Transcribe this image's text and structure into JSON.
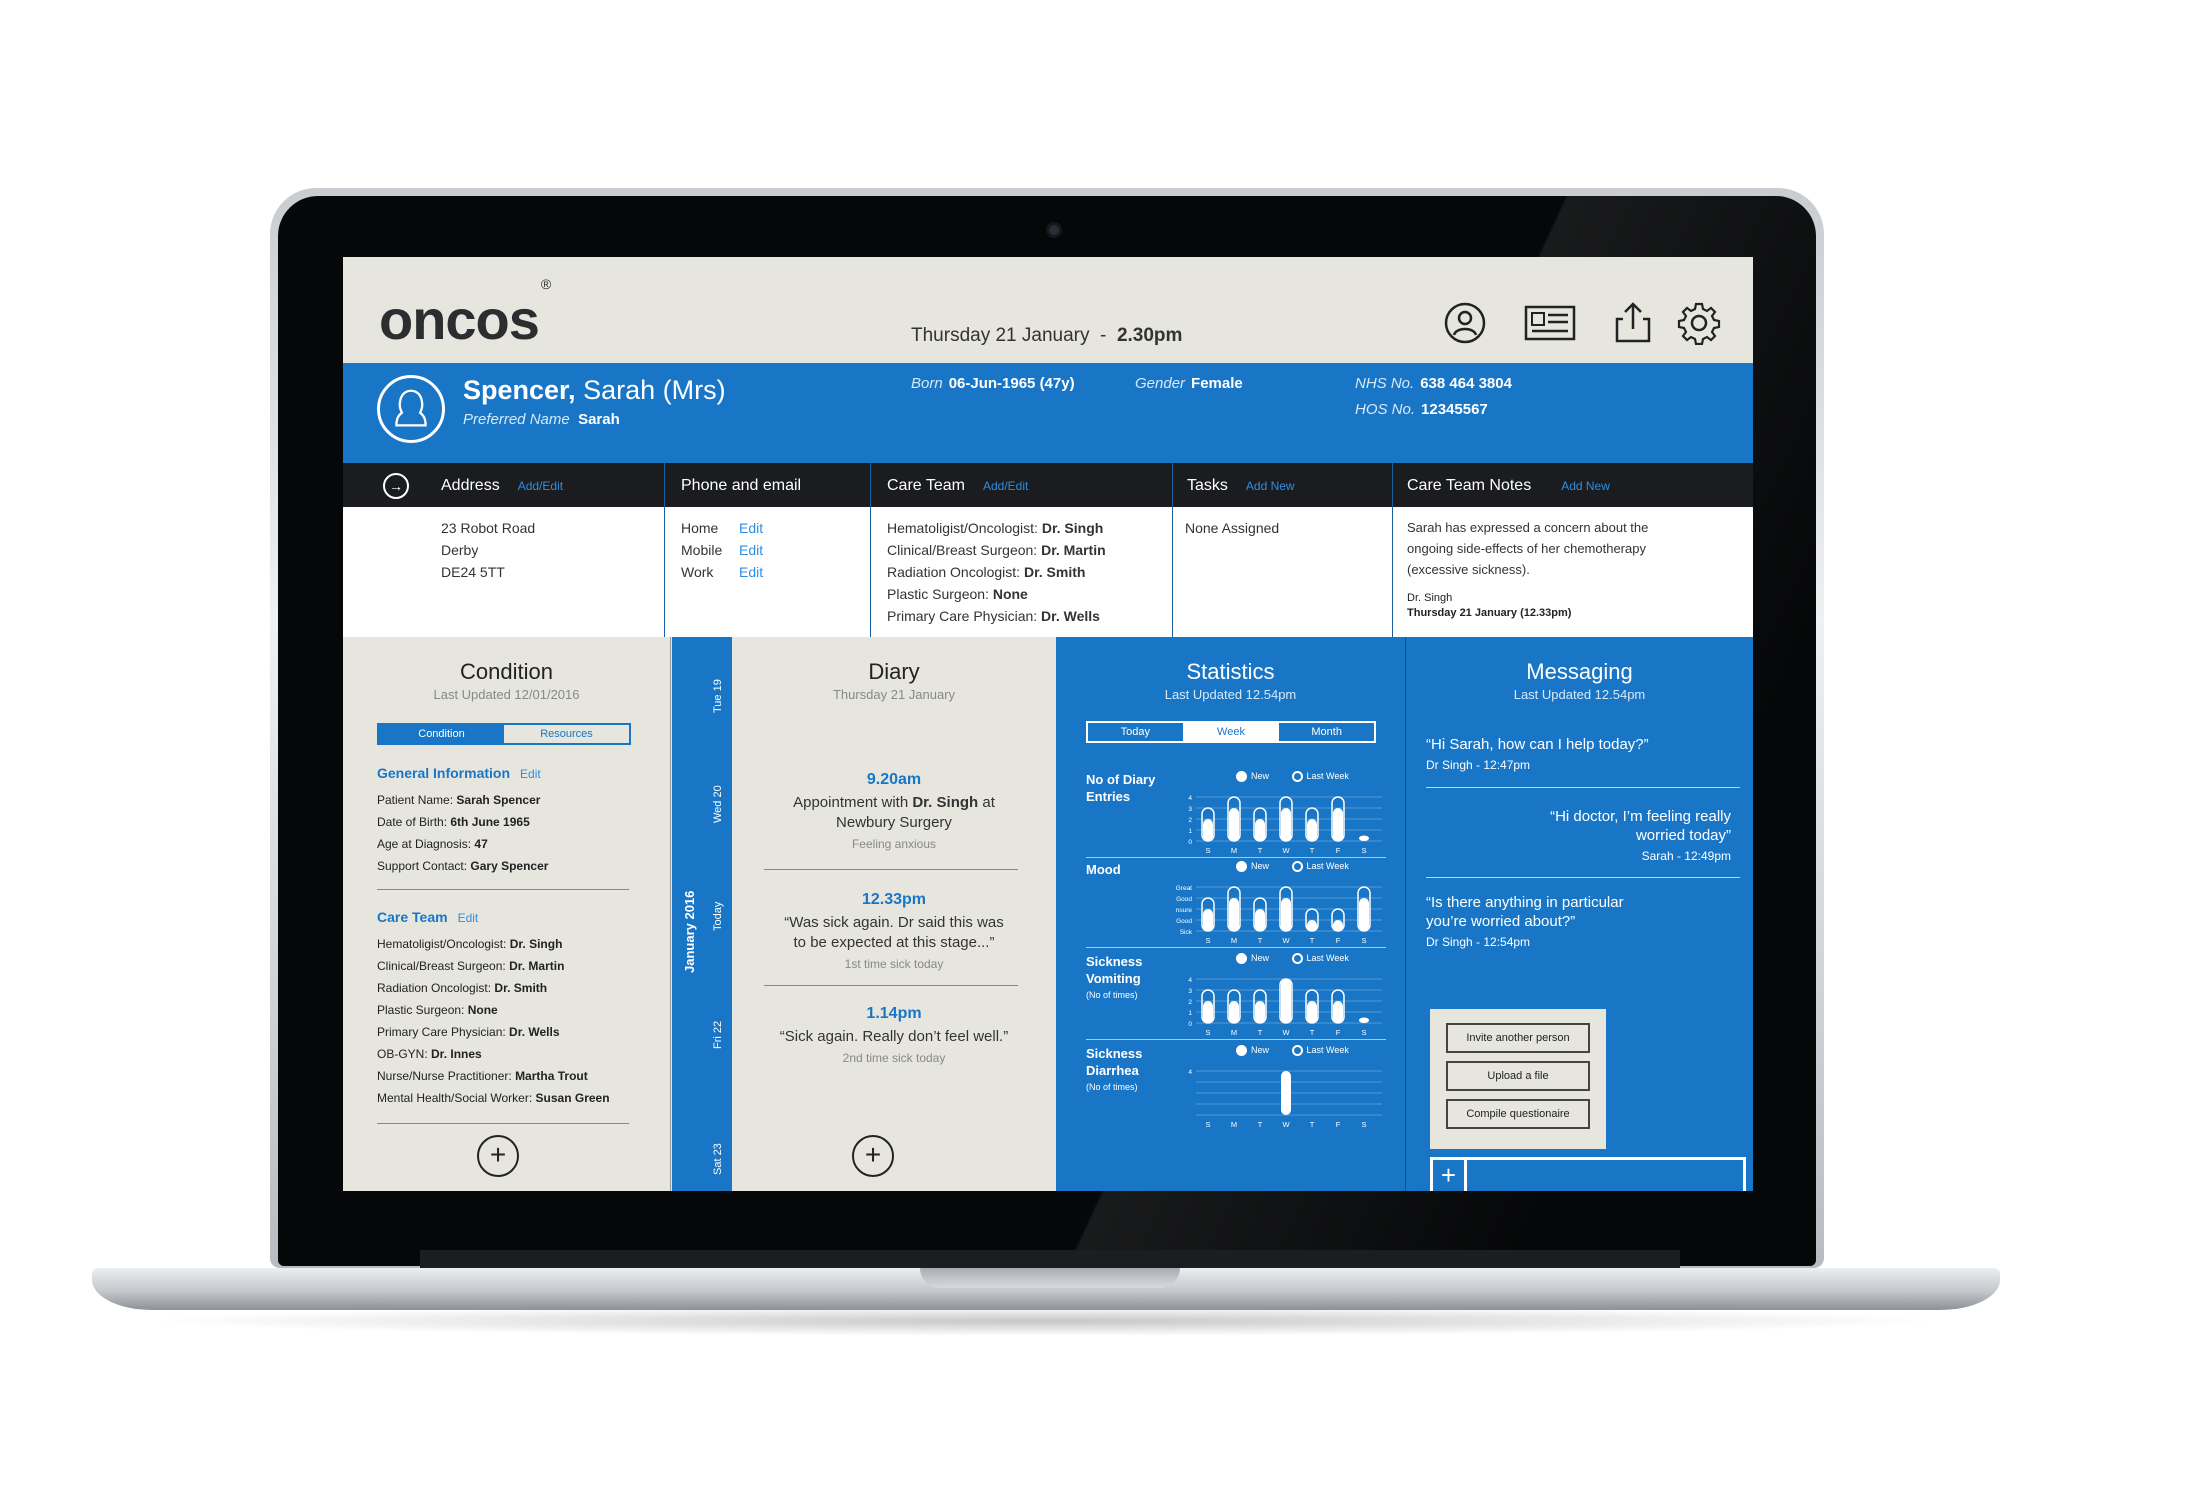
{
  "app": {
    "logo": "oncos",
    "logo_mark": "®",
    "date": "Thursday 21 January",
    "time": "2.30pm"
  },
  "toolbar": {
    "icons": [
      "profile-icon",
      "record-card-icon",
      "share-icon",
      "settings-icon"
    ]
  },
  "patient": {
    "surname": "Spencer,",
    "given": "Sarah (Mrs)",
    "preferred_label": "Preferred Name",
    "preferred": "Sarah",
    "born_label": "Born",
    "born": "06-Jun-1965 (47y)",
    "gender_label": "Gender",
    "gender": "Female",
    "nhs_label": "NHS No.",
    "nhs": "638 464 3804",
    "hos_label": "HOS No.",
    "hos": "12345567"
  },
  "info": {
    "address": {
      "title": "Address",
      "action": "Add/Edit",
      "lines": [
        "23 Robot Road",
        "Derby",
        "DE24 5TT"
      ]
    },
    "phone": {
      "title": "Phone and email",
      "rows": [
        {
          "label": "Home",
          "action": "Edit"
        },
        {
          "label": "Mobile",
          "action": "Edit"
        },
        {
          "label": "Work",
          "action": "Edit"
        }
      ]
    },
    "care_team": {
      "title": "Care Team",
      "action": "Add/Edit",
      "rows": [
        {
          "role": "Hematoligist/Oncologist:",
          "name": "Dr. Singh"
        },
        {
          "role": "Clinical/Breast Surgeon:",
          "name": "Dr. Martin"
        },
        {
          "role": "Radiation Oncologist:",
          "name": "Dr. Smith"
        },
        {
          "role": "Plastic Surgeon:",
          "name": "None"
        },
        {
          "role": "Primary Care Physician:",
          "name": "Dr. Wells"
        }
      ]
    },
    "tasks": {
      "title": "Tasks",
      "action": "Add New",
      "body": "None Assigned"
    },
    "notes": {
      "title": "Care Team Notes",
      "action": "Add New",
      "body": "Sarah has expressed a concern about the ongoing side-effects of her chemotherapy (excessive sickness).",
      "author": "Dr. Singh",
      "date": "Thursday 21 January (12.33pm)"
    }
  },
  "condition": {
    "title": "Condition",
    "updated": "Last Updated 12/01/2016",
    "tabs": [
      "Condition",
      "Resources"
    ],
    "general": {
      "title": "General Information",
      "action": "Edit",
      "rows": [
        {
          "label": "Patient Name:",
          "value": "Sarah Spencer"
        },
        {
          "label": "Date of Birth:",
          "value": "6th June 1965"
        },
        {
          "label": "Age at Diagnosis:",
          "value": "47"
        },
        {
          "label": "Support Contact:",
          "value": "Gary Spencer"
        }
      ]
    },
    "care": {
      "title": "Care Team",
      "action": "Edit",
      "rows": [
        {
          "label": "Hematoligist/Oncologist:",
          "value": "Dr. Singh"
        },
        {
          "label": "Clinical/Breast Surgeon:",
          "value": "Dr. Martin"
        },
        {
          "label": "Radiation Oncologist:",
          "value": "Dr. Smith"
        },
        {
          "label": "Plastic Surgeon:",
          "value": "None"
        },
        {
          "label": "Primary Care Physician:",
          "value": "Dr. Wells"
        },
        {
          "label": "OB-GYN:",
          "value": "Dr. Innes"
        },
        {
          "label": "Nurse/Nurse Practitioner:",
          "value": "Martha Trout"
        },
        {
          "label": "Mental Health/Social Worker:",
          "value": "Susan Green"
        }
      ]
    },
    "add": "+"
  },
  "datestrip": {
    "month": "January 2016",
    "days": [
      "Tue 19",
      "Wed 20",
      "Today",
      "Fri 22",
      "Sat 23"
    ]
  },
  "diary": {
    "title": "Diary",
    "subtitle": "Thursday 21 January",
    "entries": [
      {
        "time": "9.20am",
        "text_pre": "Appointment with ",
        "text_bold": "Dr. Singh",
        "text_post": " at Newbury Surgery",
        "note": "Feeling anxious"
      },
      {
        "time": "12.33pm",
        "text_pre": "“Was sick again. Dr said this was to be expected at this stage...”",
        "text_bold": "",
        "text_post": "",
        "note": "1st time sick today"
      },
      {
        "time": "1.14pm",
        "text_pre": "“Sick again. Really don’t feel well.”",
        "text_bold": "",
        "text_post": "",
        "note": "2nd time sick today"
      }
    ],
    "add": "+"
  },
  "statistics": {
    "title": "Statistics",
    "updated": "Last Updated 12.54pm",
    "tabs": [
      "Today",
      "Week",
      "Month"
    ],
    "active_tab": "Week",
    "legend_new": "New",
    "legend_last": "Last Week",
    "days": [
      "S",
      "M",
      "T",
      "W",
      "T",
      "F",
      "S"
    ],
    "blocks": [
      {
        "label": "No of Diary Entries",
        "sub": "",
        "yticks": [
          "4",
          "3",
          "2",
          "1",
          "0"
        ],
        "ymax": 4,
        "new": [
          2,
          3,
          2,
          3,
          2,
          3,
          0.5
        ],
        "last": [
          3,
          4,
          3,
          4,
          3,
          4,
          0
        ]
      },
      {
        "label": "Mood",
        "sub": "",
        "yticks": [
          "Great",
          "Good",
          "Unsure",
          "Not Good",
          "Sick"
        ],
        "ymax": 4,
        "new": [
          2,
          3,
          2,
          3,
          1,
          1,
          3
        ],
        "last": [
          3,
          4,
          3,
          4,
          2,
          2,
          4
        ]
      },
      {
        "label": "Sickness Vomiting",
        "sub": "(No of times)",
        "yticks": [
          "4",
          "3",
          "2",
          "1",
          "0"
        ],
        "ymax": 4,
        "new": [
          2,
          2,
          2,
          4,
          2,
          2,
          0.5
        ],
        "last": [
          3,
          3,
          3,
          4,
          3,
          3,
          0
        ]
      },
      {
        "label": "Sickness Diarrhea",
        "sub": "(No of times)",
        "yticks": [
          "4"
        ],
        "ymax": 4,
        "new": [
          0,
          0,
          0,
          4,
          0,
          0,
          0
        ],
        "last": [
          0,
          0,
          0,
          0,
          0,
          0,
          0
        ]
      }
    ],
    "chart_data": {
      "type": "bar",
      "categories": [
        "S",
        "M",
        "T",
        "W",
        "T",
        "F",
        "S"
      ],
      "series": [
        {
          "name": "New",
          "values": [
            2,
            3,
            2,
            3,
            2,
            3,
            0.5
          ]
        },
        {
          "name": "Last Week",
          "values": [
            3,
            4,
            3,
            4,
            3,
            4,
            0
          ]
        }
      ],
      "ylim": [
        0,
        4
      ]
    }
  },
  "messaging": {
    "title": "Messaging",
    "updated": "Last Updated 12.54pm",
    "messages": [
      {
        "text": "“Hi Sarah, how can I help today?”",
        "meta": "Dr Singh - 12:47pm",
        "align": "left"
      },
      {
        "text": "“Hi doctor, I’m feeling really worried today”",
        "meta": "Sarah - 12:49pm",
        "align": "right"
      },
      {
        "text": "“Is there anything in particular you’re worried about?”",
        "meta": "Dr Singh - 12:54pm",
        "align": "left"
      }
    ],
    "actions": [
      "Invite another person",
      "Upload a file",
      "Compile questionaire"
    ],
    "compose_add": "+"
  },
  "colors": {
    "brand": "#1976c7",
    "panel": "#e6e6de",
    "dark": "#1b1c1f"
  }
}
